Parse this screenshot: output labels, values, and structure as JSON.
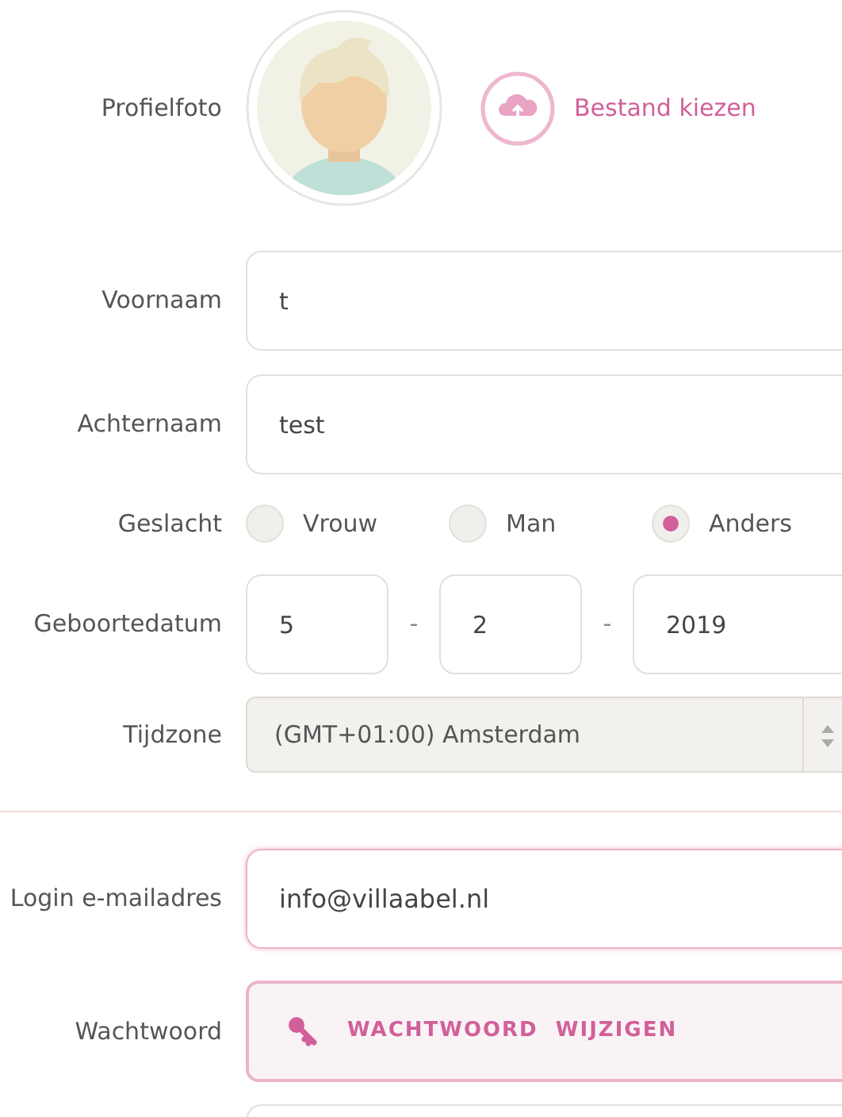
{
  "profile_photo": {
    "label": "Profielfoto",
    "button": "Bestand kiezen"
  },
  "first_name": {
    "label": "Voornaam",
    "value": "t"
  },
  "last_name": {
    "label": "Achternaam",
    "value": "test"
  },
  "gender": {
    "label": "Geslacht",
    "options": [
      {
        "label": "Vrouw",
        "selected": false
      },
      {
        "label": "Man",
        "selected": false
      },
      {
        "label": "Anders",
        "selected": true
      }
    ]
  },
  "birth_date": {
    "label": "Geboortedatum",
    "day": "5",
    "month": "2",
    "year": "2019",
    "separators": [
      "-",
      "-"
    ]
  },
  "timezone": {
    "label": "Tijdzone",
    "value": "(GMT+01:00) Amsterdam"
  },
  "login_email": {
    "label": "Login e-mailadres",
    "value": "info@villaabel.nl",
    "focused": true
  },
  "password": {
    "label": "Wachtwoord",
    "button": "WACHTWOORD  WIJZIGEN"
  }
}
